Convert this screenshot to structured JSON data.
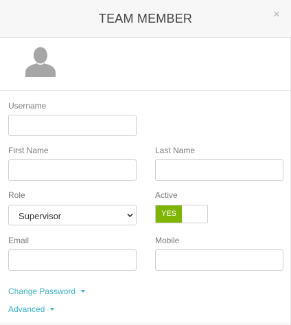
{
  "modal": {
    "title": "TEAM MEMBER",
    "close_glyph": "×"
  },
  "avatar": {
    "icon": "user-silhouette-icon",
    "color": "#a6a6a6"
  },
  "form": {
    "username": {
      "label": "Username",
      "value": ""
    },
    "first_name": {
      "label": "First Name",
      "value": ""
    },
    "last_name": {
      "label": "Last Name",
      "value": ""
    },
    "role": {
      "label": "Role",
      "selected": "Supervisor"
    },
    "active": {
      "label": "Active",
      "state_label": "YES",
      "on_color": "#7fb400"
    },
    "email": {
      "label": "Email",
      "value": ""
    },
    "mobile": {
      "label": "Mobile",
      "value": ""
    }
  },
  "links": {
    "change_password": "Change Password",
    "advanced": "Advanced",
    "color": "#3ab0c8"
  }
}
